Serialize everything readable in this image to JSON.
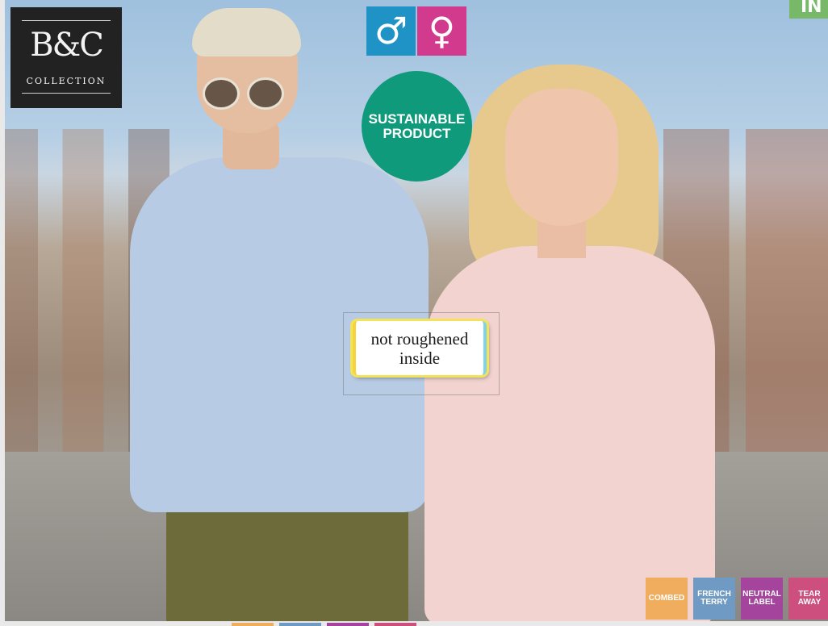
{
  "brand": {
    "mark": "B&C",
    "word": "COLLECTION"
  },
  "gender_icons": [
    {
      "name": "male",
      "glyph": "♂",
      "color": "#1f93c6"
    },
    {
      "name": "female",
      "glyph": "♀",
      "color": "#d23a8d"
    }
  ],
  "badge": {
    "line1": "SUSTAINABLE",
    "line2": "PRODUCT",
    "color": "#0f9a7c"
  },
  "label": {
    "line1": "not roughened",
    "line2": "inside"
  },
  "corner_tab": {
    "text": "IN",
    "color": "#78b869"
  },
  "features": [
    {
      "line1": "COMBED",
      "line2": "",
      "color": "#f0ad5e"
    },
    {
      "line1": "FRENCH",
      "line2": "TERRY",
      "color": "#6f9ac3"
    },
    {
      "line1": "NEUTRAL",
      "line2": "LABEL",
      "color": "#a4449c"
    },
    {
      "line1": "TEAR",
      "line2": "AWAY",
      "color": "#cc4f7e"
    }
  ]
}
